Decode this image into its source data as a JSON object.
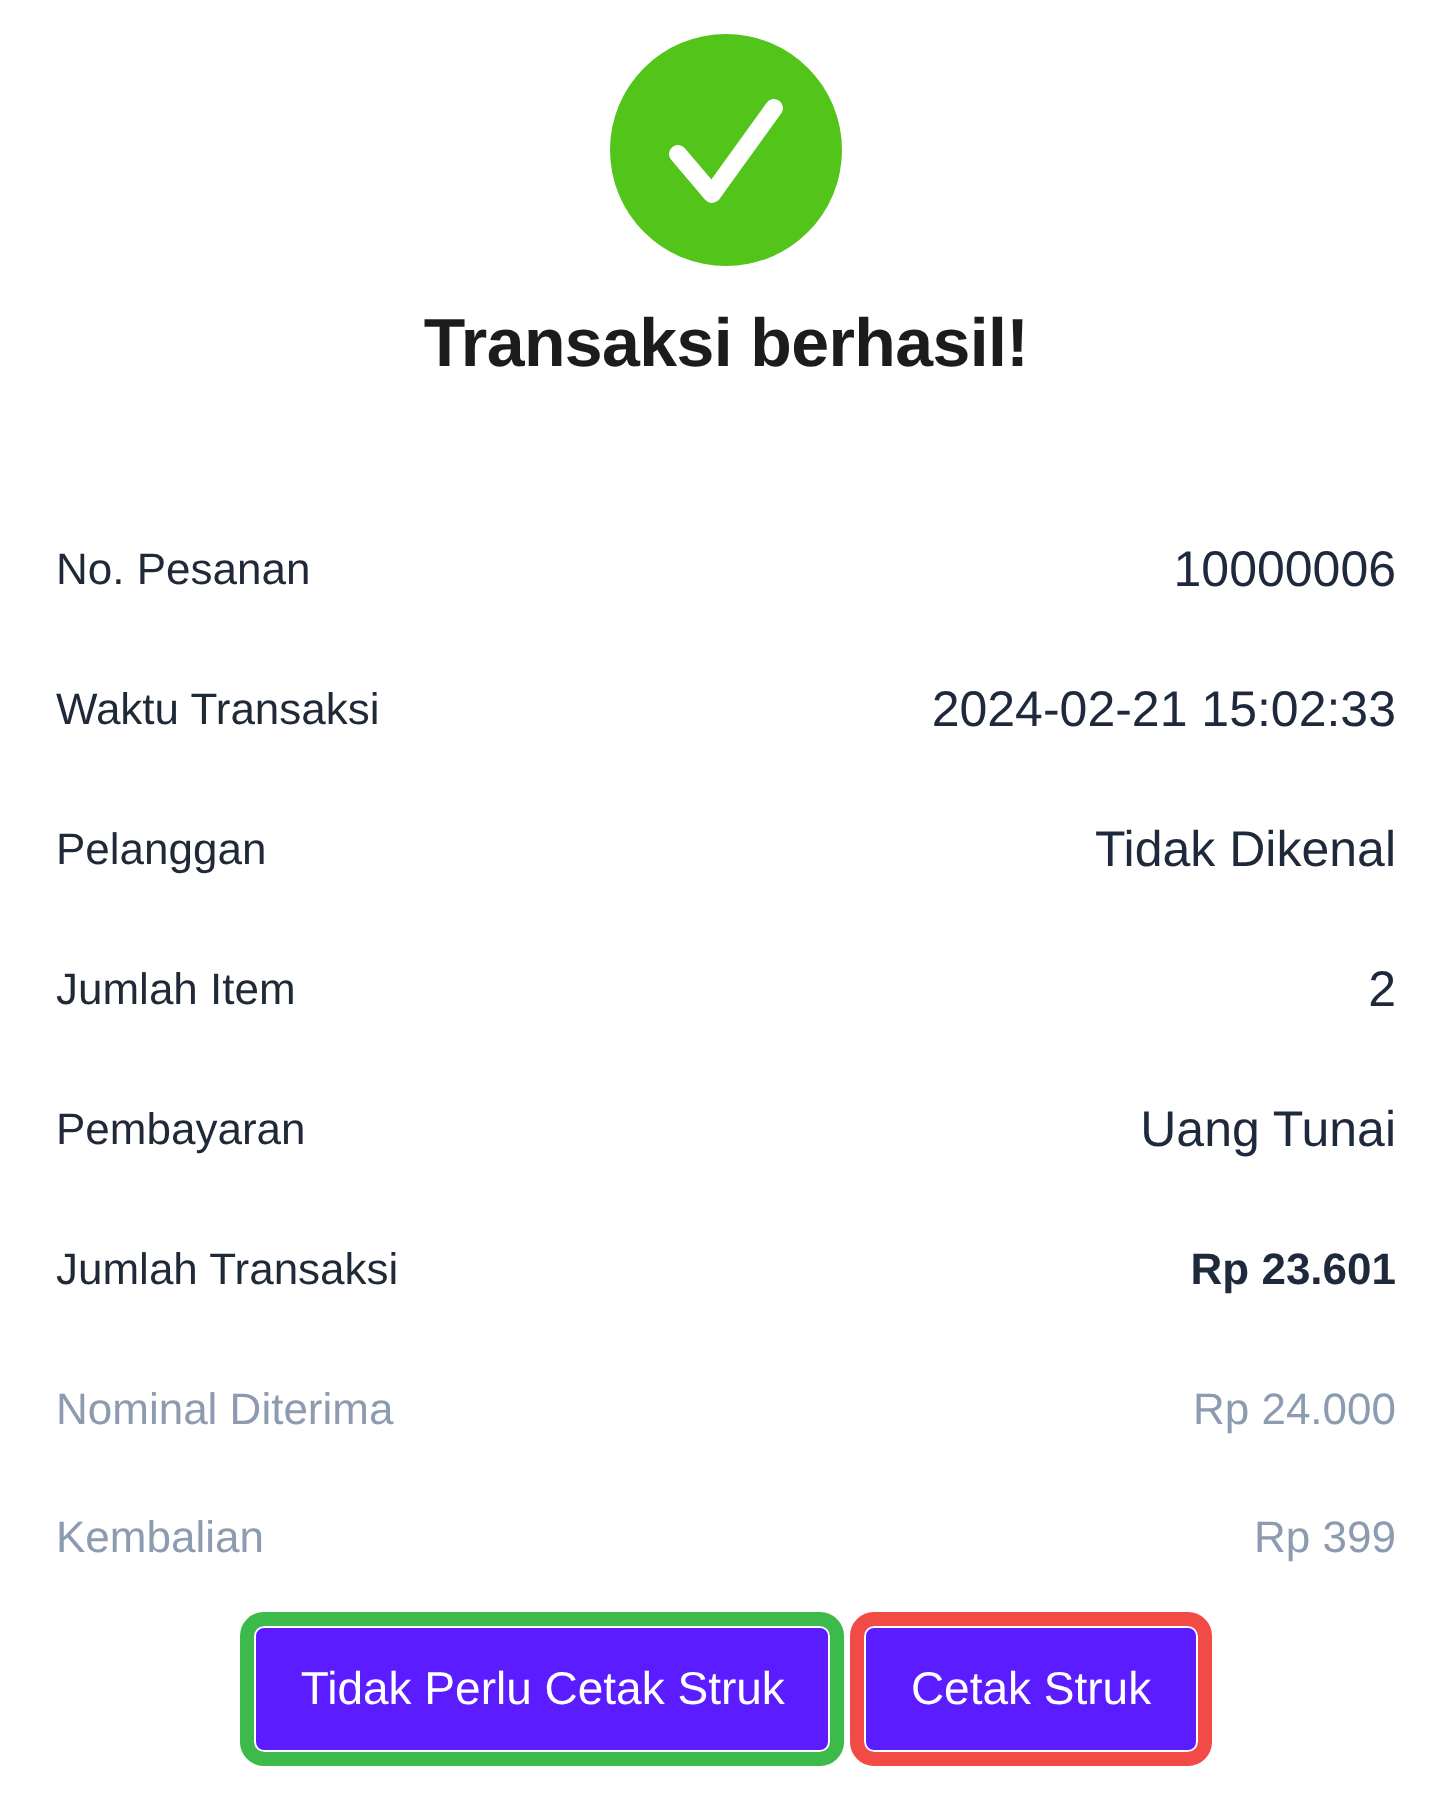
{
  "status": {
    "title": "Transaksi berhasil!"
  },
  "details": [
    {
      "label": "No. Pesanan",
      "value": "10000006",
      "kind": "primary"
    },
    {
      "label": "Waktu Transaksi",
      "value": "2024-02-21 15:02:33",
      "kind": "primary"
    },
    {
      "label": "Pelanggan",
      "value": "Tidak Dikenal",
      "kind": "primary"
    },
    {
      "label": "Jumlah Item",
      "value": "2",
      "kind": "primary"
    },
    {
      "label": "Pembayaran",
      "value": "Uang Tunai",
      "kind": "primary"
    },
    {
      "label": "Jumlah Transaksi",
      "value": "Rp 23.601",
      "kind": "total"
    },
    {
      "label": "Nominal Diterima",
      "value": "Rp 24.000",
      "kind": "muted"
    },
    {
      "label": "Kembalian",
      "value": "Rp 399",
      "kind": "muted"
    }
  ],
  "buttons": [
    {
      "label": "Tidak Perlu Cetak Struk",
      "color": "#3cba4a"
    },
    {
      "label": "Cetak Struk",
      "color": "#f24b46"
    }
  ]
}
